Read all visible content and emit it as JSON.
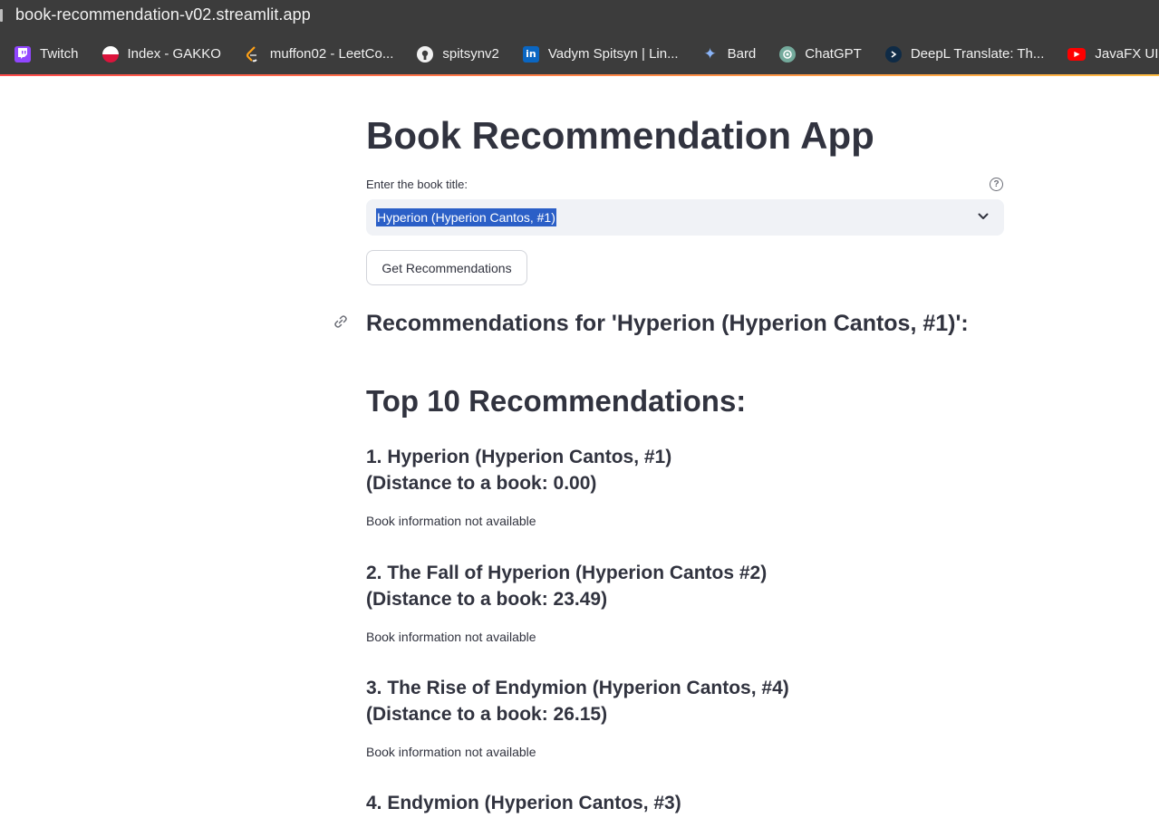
{
  "browser": {
    "url": "book-recommendation-v02.streamlit.app",
    "bookmarks": [
      {
        "label": "Twitch",
        "icon": "twitch-icon",
        "glyph": ""
      },
      {
        "label": "Index - GAKKO",
        "icon": "gakko-icon",
        "glyph": ""
      },
      {
        "label": "muffon02 - LeetCo...",
        "icon": "leetcode-icon",
        "glyph": ""
      },
      {
        "label": "spitsynv2",
        "icon": "github-icon",
        "glyph": ""
      },
      {
        "label": "Vadym Spitsyn | Lin...",
        "icon": "linkedin-icon",
        "glyph": "in"
      },
      {
        "label": "Bard",
        "icon": "bard-icon",
        "glyph": "✦"
      },
      {
        "label": "ChatGPT",
        "icon": "chatgpt-icon",
        "glyph": ""
      },
      {
        "label": "DeepL Translate: Th...",
        "icon": "deepl-icon",
        "glyph": ""
      },
      {
        "label": "JavaFX UI: Library D",
        "icon": "youtube-icon",
        "glyph": "▶"
      }
    ]
  },
  "app": {
    "title": "Book Recommendation App",
    "input_label": "Enter the book title:",
    "selected_book": "Hyperion (Hyperion Cantos, #1)",
    "button_label": "Get Recommendations",
    "recommendations_heading": "Recommendations for 'Hyperion (Hyperion Cantos, #1)':",
    "top_heading": "Top 10 Recommendations:",
    "items": [
      {
        "title_line": "1. Hyperion (Hyperion Cantos, #1)",
        "distance_line": "(Distance to a book: 0.00)",
        "info": "Book information not available"
      },
      {
        "title_line": "2. The Fall of Hyperion (Hyperion Cantos #2)",
        "distance_line": "(Distance to a book: 23.49)",
        "info": "Book information not available"
      },
      {
        "title_line": "3. The Rise of Endymion (Hyperion Cantos, #4)",
        "distance_line": "(Distance to a book: 26.15)",
        "info": "Book information not available"
      },
      {
        "title_line": "4. Endymion (Hyperion Cantos, #3)",
        "distance_line": "",
        "info": ""
      }
    ]
  },
  "colors": {
    "chrome": "#3c3c3c",
    "text": "#31333f",
    "select_bg": "#f0f2f6",
    "selection": "#2b5fc7"
  }
}
